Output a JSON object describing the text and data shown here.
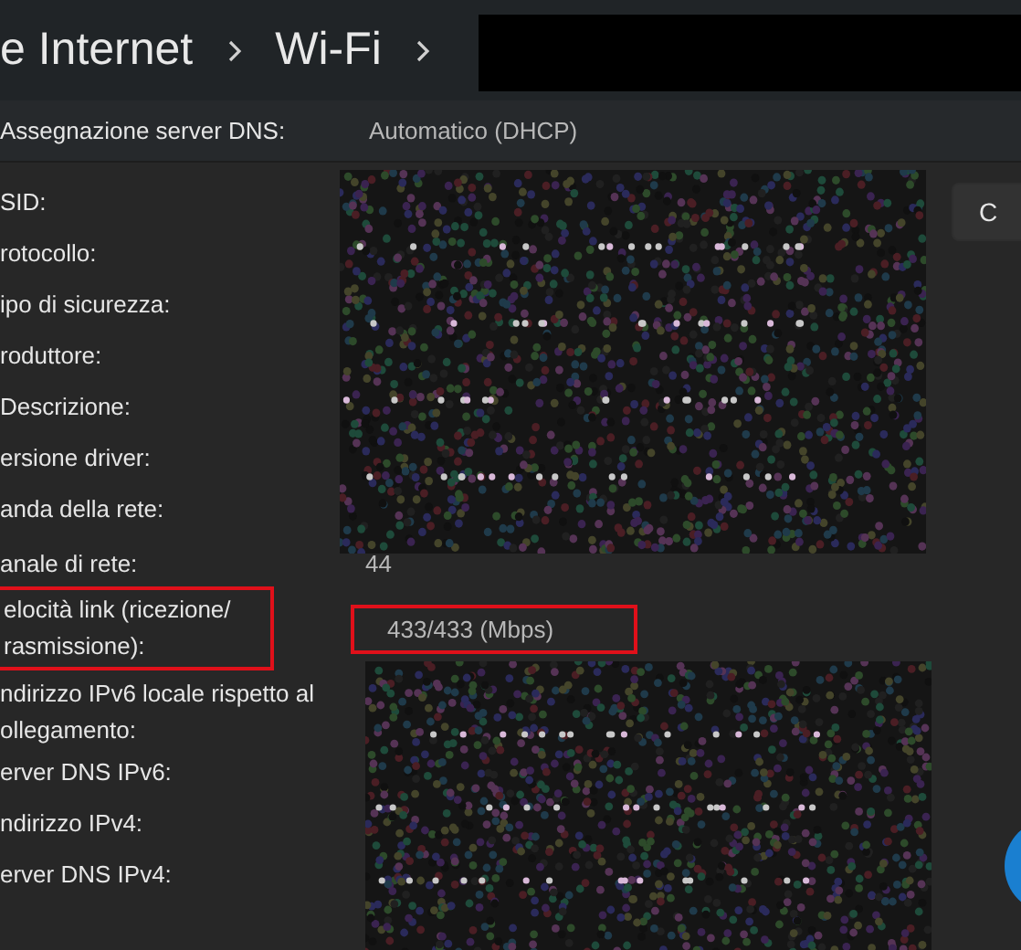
{
  "breadcrumb": [
    {
      "label": "e Internet"
    },
    {
      "label": "Wi-Fi"
    }
  ],
  "dns_assignment": {
    "label": "Assegnazione server DNS:",
    "value": "Automatico (DHCP)"
  },
  "sections": [
    {
      "kind": "redacted",
      "rows": [
        {
          "label": "SID:"
        },
        {
          "label": "rotocollo:"
        },
        {
          "label": "ipo di sicurezza:"
        },
        {
          "label": "roduttore:"
        },
        {
          "label": "Descrizione:"
        },
        {
          "label": "ersione driver:"
        },
        {
          "label": "anda della rete:"
        }
      ]
    },
    {
      "kind": "plain",
      "rows": [
        {
          "label": "anale di rete:",
          "value": "44",
          "highlighted": false
        },
        {
          "label": "elocità link (ricezione/ rasmissione):",
          "value": "433/433 (Mbps)",
          "highlighted": true
        }
      ]
    },
    {
      "kind": "redacted",
      "rows": [
        {
          "label": "ndirizzo IPv6 locale rispetto al ollegamento:"
        },
        {
          "label": "erver DNS IPv6:"
        },
        {
          "label": "ndirizzo IPv4:"
        },
        {
          "label": "erver DNS IPv4:"
        }
      ]
    }
  ],
  "side_button": {
    "label": "C"
  }
}
